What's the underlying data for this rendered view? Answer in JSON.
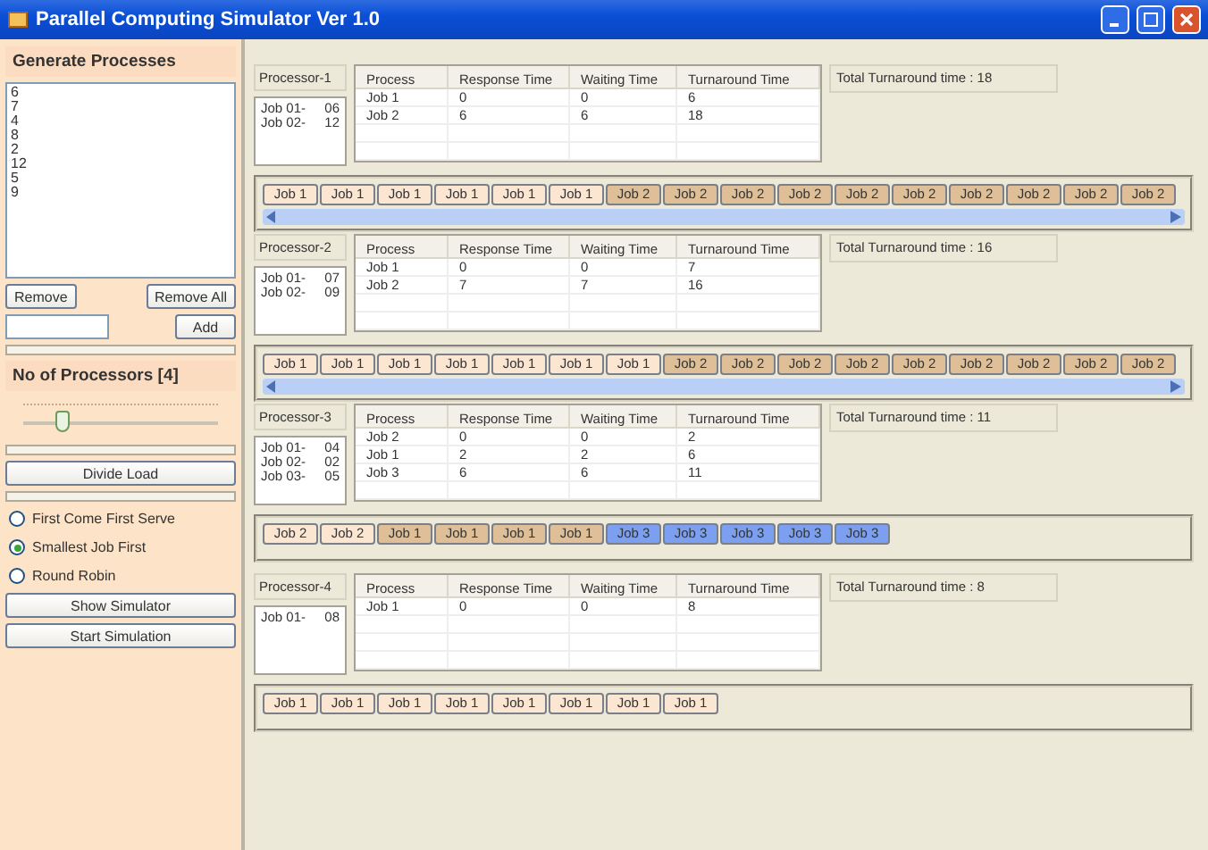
{
  "window": {
    "title": "Parallel Computing Simulator Ver 1.0"
  },
  "sidebar": {
    "generate_title": "Generate Processes",
    "processes": [
      "6",
      "7",
      "4",
      "8",
      "2",
      "12",
      "5",
      "9"
    ],
    "remove_button": "Remove",
    "remove_all_button": "Remove All",
    "add_button": "Add",
    "processors_title": "No of Processors [4]",
    "processor_slider": {
      "level": 0.2
    },
    "divide_button": "Divide Load",
    "algorithms": [
      {
        "label": "First Come First Serve",
        "selected": false
      },
      {
        "label": "Smallest Job First",
        "selected": true
      },
      {
        "label": "Round Robin",
        "selected": false
      }
    ],
    "show_button": "Show Simulator",
    "start_button": "Start Simulation"
  },
  "processors": [
    {
      "name": "Processor-1",
      "jobs": [
        {
          "label": "Job 01-",
          "burst": "06"
        },
        {
          "label": "Job 02-",
          "burst": "12"
        }
      ],
      "columns": [
        "Process",
        "Response Time",
        "Waiting Time",
        "Turnaround Time"
      ],
      "rows": [
        [
          "Job 1",
          "0",
          "0",
          "6"
        ],
        [
          "Job 2",
          "6",
          "6",
          "18"
        ]
      ],
      "total": "Total Turnaround time : 18",
      "has_scrollbar": true,
      "timeline": [
        {
          "label": "Job 1",
          "color": "#fbe6d2"
        },
        {
          "label": "Job 1",
          "color": "#fbe6d2"
        },
        {
          "label": "Job 1",
          "color": "#fbe6d2"
        },
        {
          "label": "Job 1",
          "color": "#fbe6d2"
        },
        {
          "label": "Job 1",
          "color": "#fbe6d2"
        },
        {
          "label": "Job 1",
          "color": "#fbe6d2"
        },
        {
          "label": "Job 2",
          "color": "#dfbf98"
        },
        {
          "label": "Job 2",
          "color": "#dfbf98"
        },
        {
          "label": "Job 2",
          "color": "#dfbf98"
        },
        {
          "label": "Job 2",
          "color": "#dfbf98"
        },
        {
          "label": "Job 2",
          "color": "#dfbf98"
        },
        {
          "label": "Job 2",
          "color": "#dfbf98"
        },
        {
          "label": "Job 2",
          "color": "#dfbf98"
        },
        {
          "label": "Job 2",
          "color": "#dfbf98"
        },
        {
          "label": "Job 2",
          "color": "#dfbf98"
        },
        {
          "label": "Job 2",
          "color": "#dfbf98"
        }
      ]
    },
    {
      "name": "Processor-2",
      "jobs": [
        {
          "label": "Job 01-",
          "burst": "07"
        },
        {
          "label": "Job 02-",
          "burst": "09"
        }
      ],
      "columns": [
        "Process",
        "Response Time",
        "Waiting Time",
        "Turnaround Time"
      ],
      "rows": [
        [
          "Job 1",
          "0",
          "0",
          "7"
        ],
        [
          "Job 2",
          "7",
          "7",
          "16"
        ]
      ],
      "total": "Total Turnaround time : 16",
      "has_scrollbar": true,
      "timeline": [
        {
          "label": "Job 1",
          "color": "#fbe6d2"
        },
        {
          "label": "Job 1",
          "color": "#fbe6d2"
        },
        {
          "label": "Job 1",
          "color": "#fbe6d2"
        },
        {
          "label": "Job 1",
          "color": "#fbe6d2"
        },
        {
          "label": "Job 1",
          "color": "#fbe6d2"
        },
        {
          "label": "Job 1",
          "color": "#fbe6d2"
        },
        {
          "label": "Job 1",
          "color": "#fbe6d2"
        },
        {
          "label": "Job 2",
          "color": "#dfbf98"
        },
        {
          "label": "Job 2",
          "color": "#dfbf98"
        },
        {
          "label": "Job 2",
          "color": "#dfbf98"
        },
        {
          "label": "Job 2",
          "color": "#dfbf98"
        },
        {
          "label": "Job 2",
          "color": "#dfbf98"
        },
        {
          "label": "Job 2",
          "color": "#dfbf98"
        },
        {
          "label": "Job 2",
          "color": "#dfbf98"
        },
        {
          "label": "Job 2",
          "color": "#dfbf98"
        },
        {
          "label": "Job 2",
          "color": "#dfbf98"
        }
      ]
    },
    {
      "name": "Processor-3",
      "jobs": [
        {
          "label": "Job 01-",
          "burst": "04"
        },
        {
          "label": "Job 02-",
          "burst": "02"
        },
        {
          "label": "Job 03-",
          "burst": "05"
        }
      ],
      "columns": [
        "Process",
        "Response Time",
        "Waiting Time",
        "Turnaround Time"
      ],
      "rows": [
        [
          "Job 2",
          "0",
          "0",
          "2"
        ],
        [
          "Job 1",
          "2",
          "2",
          "6"
        ],
        [
          "Job 3",
          "6",
          "6",
          "11"
        ]
      ],
      "total": "Total Turnaround time : 11",
      "has_scrollbar": false,
      "timeline": [
        {
          "label": "Job 2",
          "color": "#fbe6d2"
        },
        {
          "label": "Job 2",
          "color": "#fbe6d2"
        },
        {
          "label": "Job 1",
          "color": "#dfbf98"
        },
        {
          "label": "Job 1",
          "color": "#dfbf98"
        },
        {
          "label": "Job 1",
          "color": "#dfbf98"
        },
        {
          "label": "Job 1",
          "color": "#dfbf98"
        },
        {
          "label": "Job 3",
          "color": "#7c9ff0"
        },
        {
          "label": "Job 3",
          "color": "#7c9ff0"
        },
        {
          "label": "Job 3",
          "color": "#7c9ff0"
        },
        {
          "label": "Job 3",
          "color": "#7c9ff0"
        },
        {
          "label": "Job 3",
          "color": "#7c9ff0"
        }
      ]
    },
    {
      "name": "Processor-4",
      "jobs": [
        {
          "label": "Job 01-",
          "burst": "08"
        }
      ],
      "columns": [
        "Process",
        "Response Time",
        "Waiting Time",
        "Turnaround Time"
      ],
      "rows": [
        [
          "Job 1",
          "0",
          "0",
          "8"
        ]
      ],
      "total": "Total Turnaround time : 8",
      "has_scrollbar": false,
      "timeline": [
        {
          "label": "Job 1",
          "color": "#fbe6d2"
        },
        {
          "label": "Job 1",
          "color": "#fbe6d2"
        },
        {
          "label": "Job 1",
          "color": "#fbe6d2"
        },
        {
          "label": "Job 1",
          "color": "#fbe6d2"
        },
        {
          "label": "Job 1",
          "color": "#fbe6d2"
        },
        {
          "label": "Job 1",
          "color": "#fbe6d2"
        },
        {
          "label": "Job 1",
          "color": "#fbe6d2"
        },
        {
          "label": "Job 1",
          "color": "#fbe6d2"
        }
      ]
    }
  ]
}
